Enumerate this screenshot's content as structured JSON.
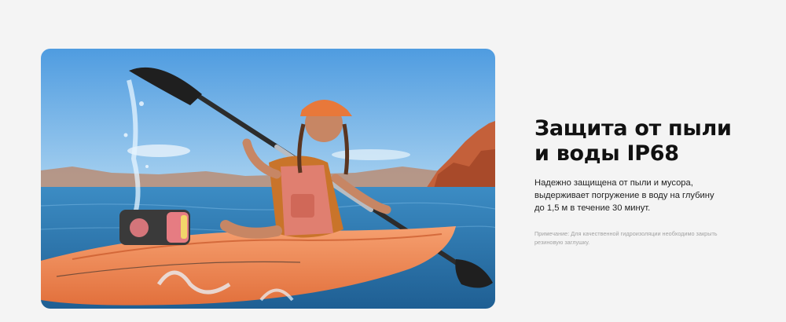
{
  "feature": {
    "headline_lines": [
      "Защита от пыли",
      "и воды IP68"
    ],
    "description_lines": [
      "Надежно защищена от пыли и мусора,",
      "выдерживает погружение в воду на глубину",
      "до 1,5 м в течение 30 минут."
    ],
    "note_lines": [
      "Примечание: Для качественной гидроизоляции необходимо закрыть",
      "резиновую заглушку."
    ]
  },
  "image": {
    "subject": "kayaker-with-speaker-photo",
    "colors": {
      "sky": "#5fa6e0",
      "water": "#2f7fb6",
      "kayak": "#f08a55",
      "cliff": "#c8643c",
      "cap": "#e8783a",
      "life_vest": "#e07f70"
    }
  }
}
